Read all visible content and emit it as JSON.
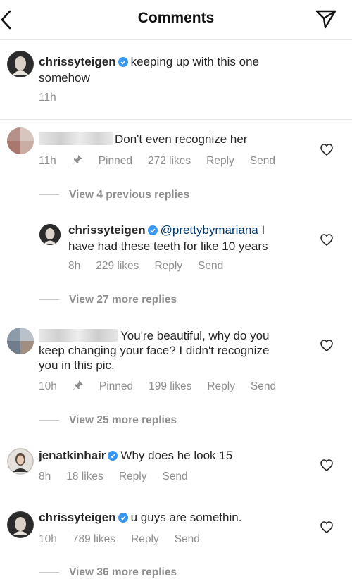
{
  "header": {
    "title": "Comments"
  },
  "caption": {
    "username": "chrissyteigen",
    "text_line1": "keeping up with this one",
    "text_line2": "somehow",
    "time": "11h"
  },
  "comments": [
    {
      "line1": "Don't even recognize her",
      "time": "11h",
      "pinned": "Pinned",
      "likes": "272 likes",
      "reply": "Reply",
      "send": "Send",
      "view_replies": "View 4 previous replies"
    },
    {
      "username": "chrissyteigen",
      "mention": "@prettybymariana",
      "line1_rest": " I",
      "line2": "have had these teeth for like 10 years",
      "time": "8h",
      "likes": "229 likes",
      "reply": "Reply",
      "send": "Send",
      "view_replies": "View 27 more replies"
    },
    {
      "line1": "You're beautiful, why do you",
      "line2": "keep changing your face? I didn't recognize",
      "line3": "you in this pic.",
      "time": "10h",
      "pinned": "Pinned",
      "likes": "199 likes",
      "reply": "Reply",
      "send": "Send",
      "view_replies": "View 25 more replies"
    },
    {
      "username": "jenatkinhair",
      "text": "Why does he look 15",
      "time": "8h",
      "likes": "18 likes",
      "reply": "Reply",
      "send": "Send"
    },
    {
      "username": "chrissyteigen",
      "text": "u guys are somethin.",
      "time": "10h",
      "likes": "789 likes",
      "reply": "Reply",
      "send": "Send",
      "view_replies": "View 36 more replies"
    }
  ],
  "colors": {
    "verified": "#3897f0",
    "mention": "#00376b",
    "meta": "#8e8e8e"
  }
}
